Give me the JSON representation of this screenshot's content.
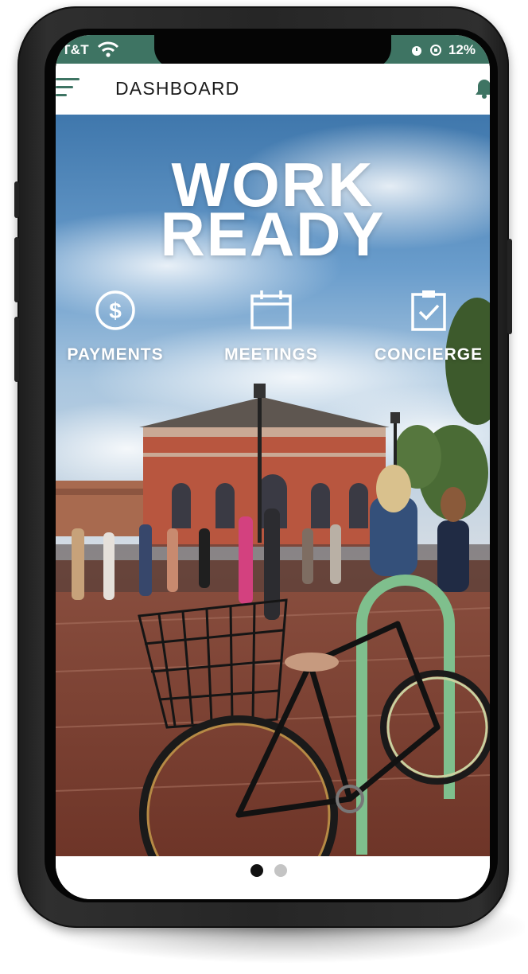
{
  "status_bar": {
    "carrier": "T&T",
    "battery": "12%",
    "icons": [
      "wifi-icon",
      "alarm-icon",
      "orientation-lock-icon"
    ]
  },
  "header": {
    "title": "DASHBOARD",
    "icons": [
      "hamburger-menu-icon",
      "bell-icon"
    ]
  },
  "hero": {
    "title_line1": "WORK",
    "title_line2": "READY",
    "background": "photo of a brick plaza with people and bicycles",
    "quick_links": [
      {
        "label": "PAYMENTS",
        "icon": "dollar-circle-icon"
      },
      {
        "label": "MEETINGS",
        "icon": "calendar-icon"
      },
      {
        "label": "CONCIERGE",
        "icon": "clipboard-check-icon"
      }
    ]
  },
  "pager": {
    "total": 2,
    "active": 1
  },
  "colors": {
    "accent": "#3e7463",
    "header_text": "#1b1b1b",
    "dot_active": "#111111",
    "dot_inactive": "#c4c4c4"
  }
}
